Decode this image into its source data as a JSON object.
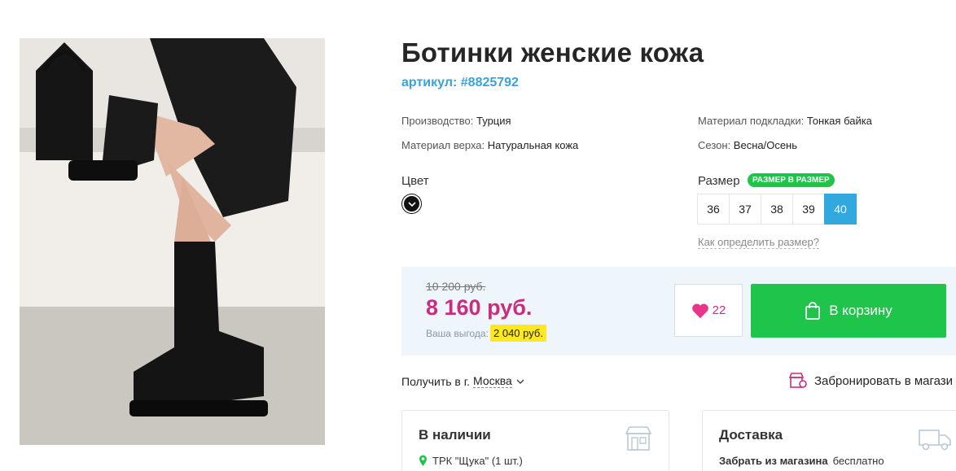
{
  "product": {
    "title": "Ботинки женские кожа",
    "sku": "артикул: #8825792"
  },
  "specs": [
    {
      "label": "Производство:",
      "value": "Турция"
    },
    {
      "label": "Материал верха:",
      "value": "Натуральная кожа"
    },
    {
      "label": "Материал подкладки:",
      "value": "Тонкая байка"
    },
    {
      "label": "Сезон:",
      "value": "Весна/Осень"
    }
  ],
  "color": {
    "label": "Цвет",
    "selected": "black",
    "swatch_hex": "#111111"
  },
  "size": {
    "label": "Размер",
    "badge": "РАЗМЕР В РАЗМЕР",
    "options": [
      "36",
      "37",
      "38",
      "39",
      "40"
    ],
    "selected": "40",
    "help_link": "Как определить размер?"
  },
  "price": {
    "old": "10 200 руб.",
    "current": "8 160 руб.",
    "savings_label": "Ваша выгода:",
    "savings_value": "2 040 руб."
  },
  "favorites": {
    "count": "22",
    "icon": "heart-icon"
  },
  "cart_button": {
    "label": "В корзину",
    "icon": "shopping-bag-icon"
  },
  "location": {
    "prefix": "Получить в г.",
    "city": "Москва",
    "reserve_label": "Забронировать в магази"
  },
  "availability": {
    "title": "В наличии",
    "store": "ТРК \"Щука\" (1 шт.)"
  },
  "delivery": {
    "title": "Доставка",
    "pickup_bold": "Забрать из магазина",
    "pickup_price": "бесплатно"
  },
  "colors": {
    "accent_blue": "#31a9de",
    "price_pink": "#c92e7e",
    "cart_green": "#1fc44a",
    "savings_yellow": "#ffe81f",
    "price_bg": "#eef5fb"
  }
}
